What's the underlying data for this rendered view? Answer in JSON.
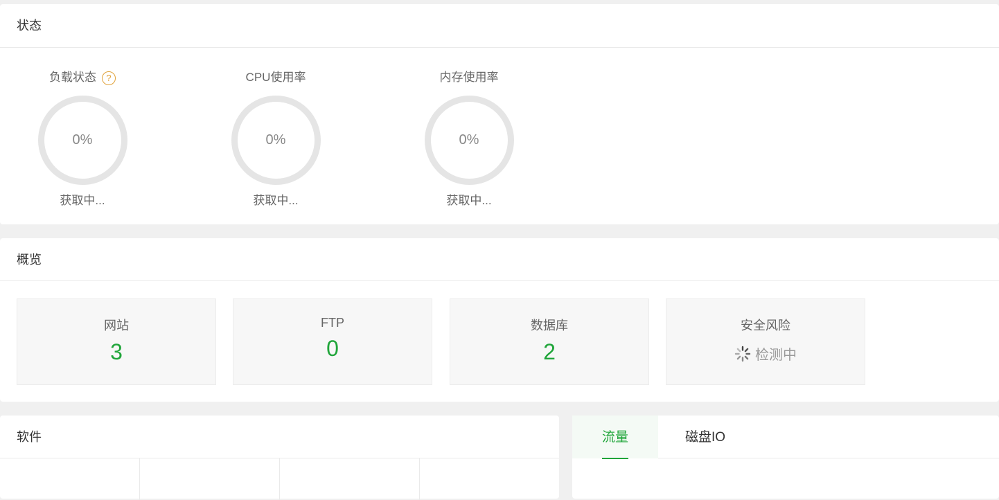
{
  "status": {
    "title": "状态",
    "gauges": [
      {
        "name": "负载状态",
        "help": "?",
        "percent": "0%",
        "value": 0,
        "status": "获取中..."
      },
      {
        "name": "CPU使用率",
        "percent": "0%",
        "value": 0,
        "status": "获取中..."
      },
      {
        "name": "内存使用率",
        "percent": "0%",
        "value": 0,
        "status": "获取中..."
      }
    ]
  },
  "overview": {
    "title": "概览",
    "cards": [
      {
        "label": "网站",
        "value": "3"
      },
      {
        "label": "FTP",
        "value": "0"
      },
      {
        "label": "数据库",
        "value": "2"
      },
      {
        "label": "安全风险",
        "detect": "检测中",
        "icon": "loading-spinner-icon"
      }
    ]
  },
  "software": {
    "title": "软件"
  },
  "traffic": {
    "tabs": [
      {
        "label": "流量",
        "active": true
      },
      {
        "label": "磁盘IO",
        "active": false
      }
    ]
  },
  "colors": {
    "accent": "#20a53a",
    "help": "#e0a23a",
    "ring": "#e5e5e5"
  }
}
